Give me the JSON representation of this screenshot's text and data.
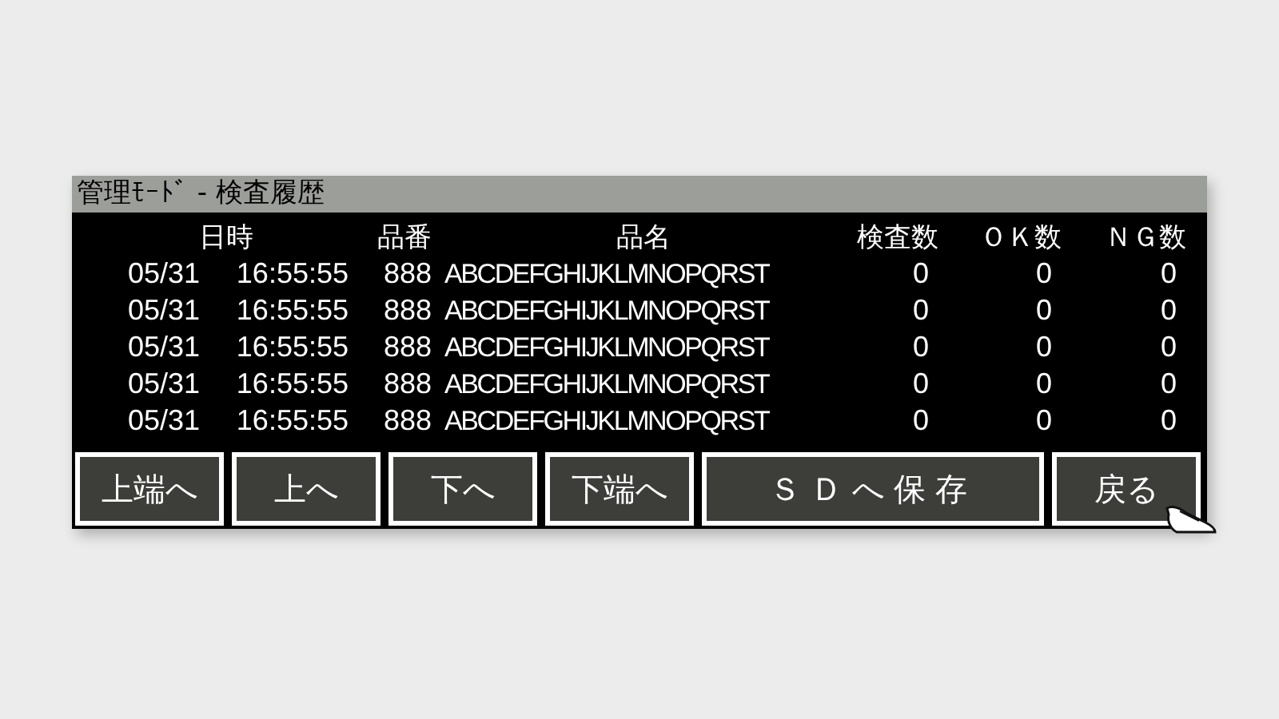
{
  "window": {
    "title": "管理ﾓｰﾄﾞ - 検査履歴"
  },
  "table": {
    "columns": [
      "日時",
      "品番",
      "品名",
      "検査数",
      "ＯＫ数",
      "ＮＧ数"
    ],
    "rows": [
      {
        "date": "05/31",
        "time": "16:55:55",
        "code": "888",
        "name": "ABCDEFGHIJKLMNOPQRST",
        "inspected": "0",
        "ok": "0",
        "ng": "0"
      },
      {
        "date": "05/31",
        "time": "16:55:55",
        "code": "888",
        "name": "ABCDEFGHIJKLMNOPQRST",
        "inspected": "0",
        "ok": "0",
        "ng": "0"
      },
      {
        "date": "05/31",
        "time": "16:55:55",
        "code": "888",
        "name": "ABCDEFGHIJKLMNOPQRST",
        "inspected": "0",
        "ok": "0",
        "ng": "0"
      },
      {
        "date": "05/31",
        "time": "16:55:55",
        "code": "888",
        "name": "ABCDEFGHIJKLMNOPQRST",
        "inspected": "0",
        "ok": "0",
        "ng": "0"
      },
      {
        "date": "05/31",
        "time": "16:55:55",
        "code": "888",
        "name": "ABCDEFGHIJKLMNOPQRST",
        "inspected": "0",
        "ok": "0",
        "ng": "0"
      }
    ]
  },
  "buttons": [
    {
      "label": "上端へ",
      "kind": "small"
    },
    {
      "label": "上へ",
      "kind": "small"
    },
    {
      "label": "下へ",
      "kind": "small"
    },
    {
      "label": "下端へ",
      "kind": "small"
    },
    {
      "label": "ＳＤへ保存",
      "kind": "wide"
    },
    {
      "label": "戻る",
      "kind": "small"
    }
  ]
}
